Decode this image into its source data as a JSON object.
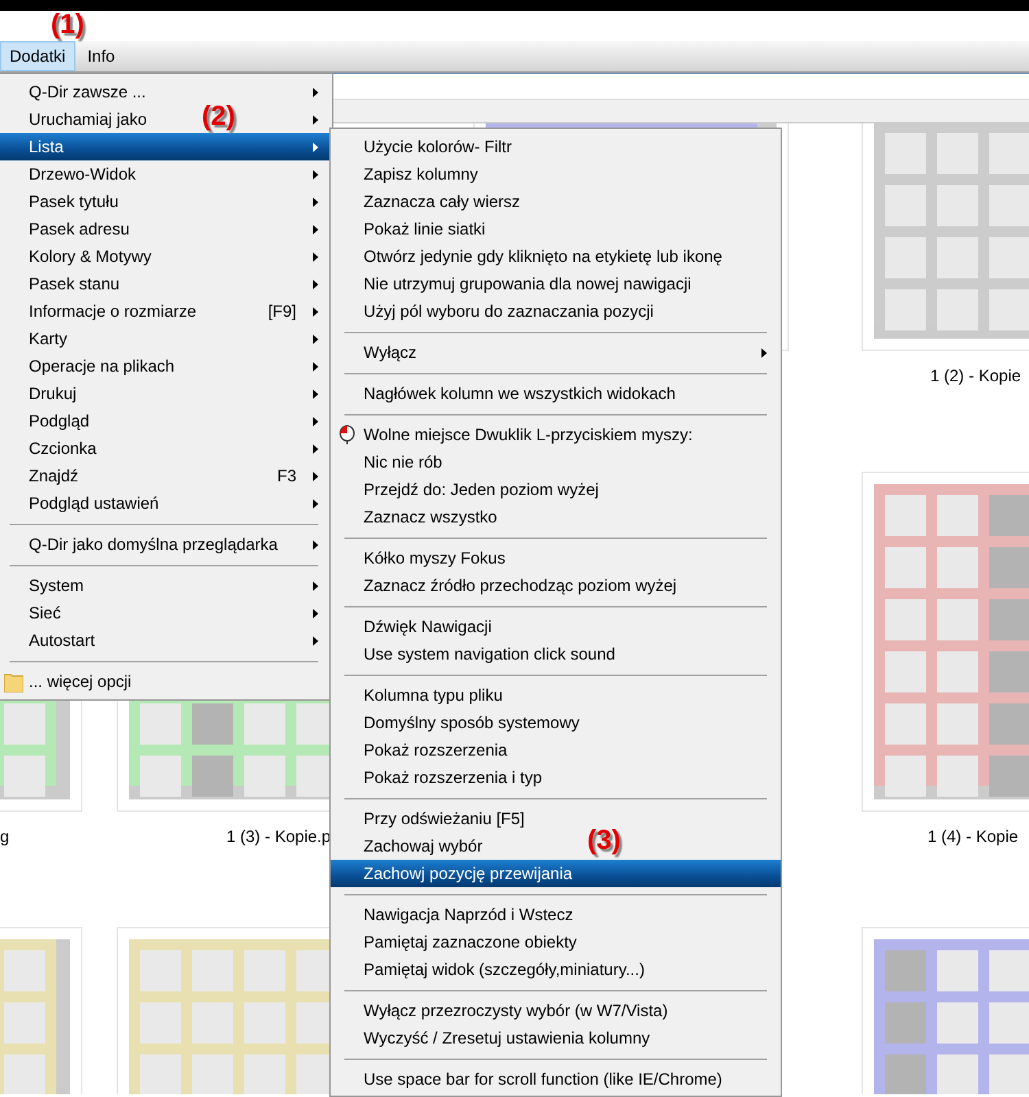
{
  "menubar": [
    {
      "label": "Dodatki",
      "selected": true
    },
    {
      "label": "Info",
      "selected": false
    }
  ],
  "thumbnails": [
    {
      "color": "#b4b4ec"
    },
    {
      "color": "#cccccc",
      "label": "1 (2) - Kopie"
    },
    {
      "color": "#b4e8b4",
      "label": "g"
    },
    {
      "color": "#b4e8b4",
      "label": "1 (3) - Kopie.p"
    },
    {
      "color": "#e8b4b4",
      "label": "1 (4) - Kopie"
    },
    {
      "color": "#e8e0b0"
    },
    {
      "color": "#e8e0b0"
    },
    {
      "color": "#b4b4ec"
    }
  ],
  "main_menu": {
    "items": [
      {
        "kind": "item",
        "label": "Q-Dir zawsze ...",
        "has_submenu": true,
        "selected": false
      },
      {
        "kind": "item",
        "label": "Uruchamiaj jako",
        "has_submenu": true,
        "selected": false
      },
      {
        "kind": "item",
        "label": "Lista",
        "has_submenu": true,
        "selected": true
      },
      {
        "kind": "item",
        "label": "Drzewo-Widok",
        "has_submenu": true,
        "selected": false
      },
      {
        "kind": "item",
        "label": "Pasek tytułu",
        "has_submenu": true,
        "selected": false
      },
      {
        "kind": "item",
        "label": "Pasek adresu",
        "has_submenu": true,
        "selected": false
      },
      {
        "kind": "item",
        "label": "Kolory & Motywy",
        "has_submenu": true,
        "selected": false
      },
      {
        "kind": "item",
        "label": "Pasek stanu",
        "has_submenu": true,
        "selected": false
      },
      {
        "kind": "item",
        "label": "Informacje o rozmiarze",
        "shortcut": "[F9]",
        "has_submenu": true,
        "selected": false
      },
      {
        "kind": "item",
        "label": "Karty",
        "has_submenu": true,
        "selected": false
      },
      {
        "kind": "item",
        "label": "Operacje na plikach",
        "has_submenu": true,
        "selected": false
      },
      {
        "kind": "item",
        "label": "Drukuj",
        "has_submenu": true,
        "selected": false
      },
      {
        "kind": "item",
        "label": "Podgląd",
        "has_submenu": true,
        "selected": false
      },
      {
        "kind": "item",
        "label": "Czcionka",
        "has_submenu": true,
        "selected": false
      },
      {
        "kind": "item",
        "label": "Znajdź",
        "shortcut": "F3",
        "has_submenu": true,
        "selected": false
      },
      {
        "kind": "item",
        "label": "Podgląd ustawień",
        "has_submenu": true,
        "selected": false
      },
      {
        "kind": "separator"
      },
      {
        "kind": "item",
        "label": "Q-Dir jako domyślna przeglądarka",
        "has_submenu": true,
        "selected": false
      },
      {
        "kind": "separator"
      },
      {
        "kind": "item",
        "label": "System",
        "has_submenu": true,
        "selected": false
      },
      {
        "kind": "item",
        "label": "Sieć",
        "has_submenu": true,
        "selected": false
      },
      {
        "kind": "item",
        "label": "Autostart",
        "has_submenu": true,
        "selected": false
      },
      {
        "kind": "separator"
      },
      {
        "kind": "folderitem",
        "label": "... więcej opcji",
        "has_submenu": false,
        "selected": false
      }
    ]
  },
  "submenu": {
    "items": [
      {
        "kind": "item",
        "label": "Użycie kolorów- Filtr",
        "has_submenu": false,
        "selected": false
      },
      {
        "kind": "item",
        "label": "Zapisz kolumny",
        "has_submenu": false,
        "selected": false
      },
      {
        "kind": "item",
        "label": "Zaznacza cały wiersz",
        "has_submenu": false,
        "selected": false
      },
      {
        "kind": "item",
        "label": "Pokaż linie siatki",
        "has_submenu": false,
        "selected": false
      },
      {
        "kind": "item",
        "label": "Otwórz jedynie gdy kliknięto na etykietę lub ikonę",
        "has_submenu": false,
        "selected": false
      },
      {
        "kind": "item",
        "label": "Nie utrzymuj grupowania dla nowej nawigacji",
        "has_submenu": false,
        "selected": false
      },
      {
        "kind": "item",
        "label": "Użyj pól wyboru do zaznaczania pozycji",
        "has_submenu": false,
        "selected": false
      },
      {
        "kind": "separator"
      },
      {
        "kind": "item",
        "label": "Wyłącz",
        "has_submenu": true,
        "selected": false
      },
      {
        "kind": "separator"
      },
      {
        "kind": "item",
        "label": "Nagłówek kolumn we wszystkich widokach",
        "has_submenu": false,
        "selected": false
      },
      {
        "kind": "separator"
      },
      {
        "kind": "mouseitem",
        "label": "Wolne miejsce Dwuklik L-przyciskiem myszy:",
        "has_submenu": false,
        "selected": false
      },
      {
        "kind": "item",
        "label": "Nic nie rób",
        "has_submenu": false,
        "selected": false
      },
      {
        "kind": "item",
        "label": "Przejdź do: Jeden poziom wyżej",
        "has_submenu": false,
        "selected": false
      },
      {
        "kind": "item",
        "label": "Zaznacz wszystko",
        "has_submenu": false,
        "selected": false
      },
      {
        "kind": "separator"
      },
      {
        "kind": "item",
        "label": "Kółko myszy Fokus",
        "has_submenu": false,
        "selected": false
      },
      {
        "kind": "item",
        "label": "Zaznacz źródło przechodząc poziom wyżej",
        "has_submenu": false,
        "selected": false
      },
      {
        "kind": "separator"
      },
      {
        "kind": "item",
        "label": "Dźwięk Nawigacji",
        "has_submenu": false,
        "selected": false
      },
      {
        "kind": "item",
        "label": "Use system navigation click sound",
        "has_submenu": false,
        "selected": false
      },
      {
        "kind": "separator"
      },
      {
        "kind": "item",
        "label": "Kolumna typu pliku",
        "has_submenu": false,
        "selected": false
      },
      {
        "kind": "item",
        "label": "Domyślny sposób systemowy",
        "has_submenu": false,
        "selected": false
      },
      {
        "kind": "item",
        "label": "Pokaż rozszerzenia",
        "has_submenu": false,
        "selected": false
      },
      {
        "kind": "item",
        "label": "Pokaż rozszerzenia i typ",
        "has_submenu": false,
        "selected": false
      },
      {
        "kind": "separator"
      },
      {
        "kind": "item",
        "label": "Przy odświeżaniu [F5]",
        "has_submenu": false,
        "selected": false
      },
      {
        "kind": "item",
        "label": "Zachowaj wybór",
        "has_submenu": false,
        "selected": false
      },
      {
        "kind": "item",
        "label": "Zachowj pozycję przewijania",
        "has_submenu": false,
        "selected": true
      },
      {
        "kind": "separator"
      },
      {
        "kind": "item",
        "label": "Nawigacja Naprzód i Wstecz",
        "has_submenu": false,
        "selected": false
      },
      {
        "kind": "item",
        "label": "Pamiętaj zaznaczone obiekty",
        "has_submenu": false,
        "selected": false
      },
      {
        "kind": "item",
        "label": "Pamiętaj widok (szczegóły,miniatury...)",
        "has_submenu": false,
        "selected": false
      },
      {
        "kind": "separator"
      },
      {
        "kind": "item",
        "label": "Wyłącz przezroczysty wybór (w W7/Vista)",
        "has_submenu": false,
        "selected": false
      },
      {
        "kind": "item",
        "label": "Wyczyść / Zresetuj ustawienia kolumny",
        "has_submenu": false,
        "selected": false
      },
      {
        "kind": "separator"
      },
      {
        "kind": "item",
        "label": "Use space bar for scroll function (like IE/Chrome)",
        "has_submenu": false,
        "selected": false
      }
    ]
  },
  "callouts": [
    "(1)",
    "(2)",
    "(3)"
  ]
}
